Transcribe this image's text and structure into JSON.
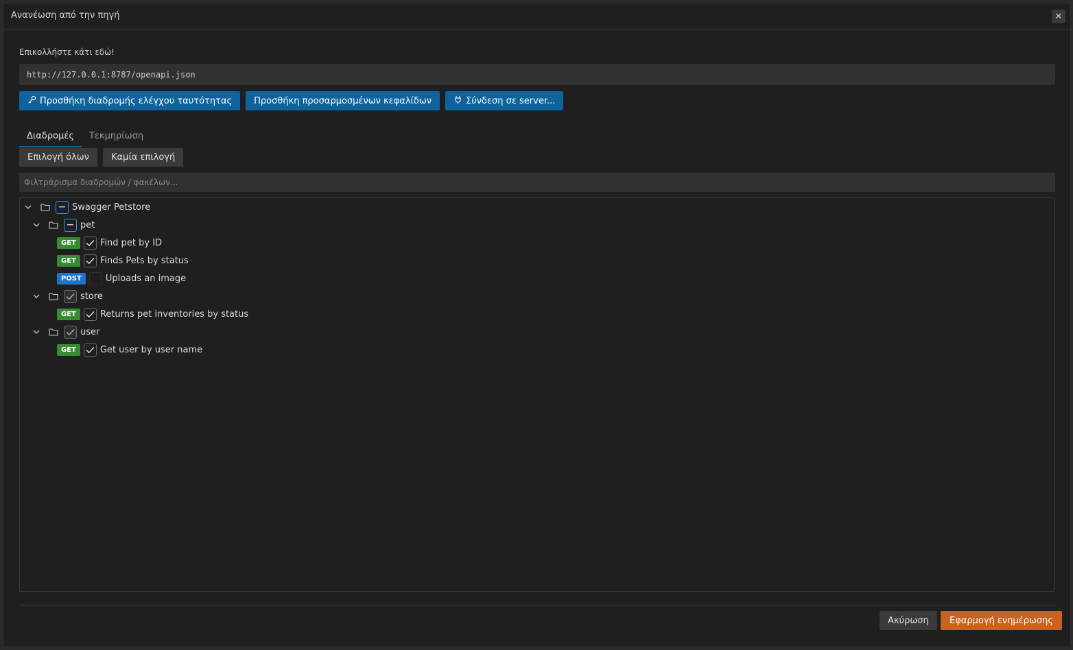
{
  "dialog": {
    "title": "Ανανέωση από την πηγή",
    "close_icon": "close-icon"
  },
  "source": {
    "label": "Επικολλήστε κάτι εδώ!",
    "url": "http://127.0.0.1:8787/openapi.json"
  },
  "actions": {
    "auth_route": "Προσθήκη διαδρομής ελέγχου ταυτότητας",
    "auth_route_icon": "key-icon",
    "custom_headers": "Προσθήκη προσαρμοσμένων κεφαλίδων",
    "connect_server": "Σύνδεση σε server...",
    "connect_server_icon": "plug-icon"
  },
  "tabs": [
    {
      "label": "Διαδρομές",
      "active": true
    },
    {
      "label": "Τεκμηρίωση",
      "active": false
    }
  ],
  "selection": {
    "select_all": "Επιλογή όλων",
    "select_none": "Καμία επιλογή"
  },
  "filter": {
    "placeholder": "Φιλτράρισμα διαδρομών / φακέλων..."
  },
  "tree": {
    "root": {
      "label": "Swagger Petstore",
      "state": "mixed"
    },
    "folders": [
      {
        "label": "pet",
        "state": "mixed",
        "routes": [
          {
            "method": "GET",
            "label": "Find pet by ID",
            "checked": true
          },
          {
            "method": "GET",
            "label": "Finds Pets by status",
            "checked": true
          },
          {
            "method": "POST",
            "label": "Uploads an image",
            "checked": false
          }
        ]
      },
      {
        "label": "store",
        "state": "checked",
        "routes": [
          {
            "method": "GET",
            "label": "Returns pet inventories by status",
            "checked": true
          }
        ]
      },
      {
        "label": "user",
        "state": "checked",
        "routes": [
          {
            "method": "GET",
            "label": "Get user by user name",
            "checked": true
          }
        ]
      }
    ]
  },
  "footer": {
    "cancel": "Ακύρωση",
    "apply": "Εφαρμογή ενημέρωσης"
  },
  "colors": {
    "primary": "#0e639c",
    "apply": "#c9611f",
    "get": "#388a34",
    "post": "#1f73c9"
  }
}
